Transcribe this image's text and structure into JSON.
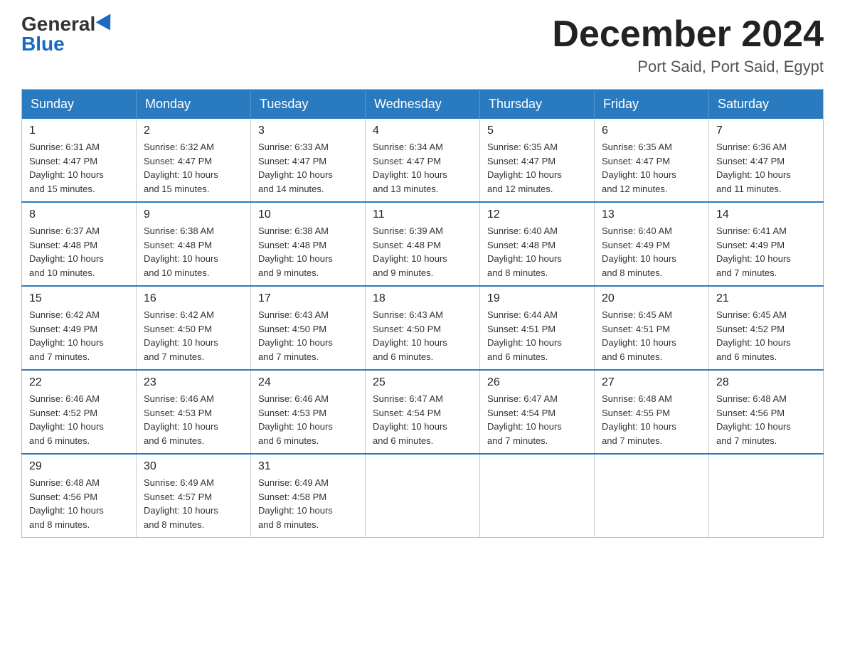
{
  "logo": {
    "general": "General",
    "blue": "Blue"
  },
  "header": {
    "month_year": "December 2024",
    "location": "Port Said, Port Said, Egypt"
  },
  "days_of_week": [
    "Sunday",
    "Monday",
    "Tuesday",
    "Wednesday",
    "Thursday",
    "Friday",
    "Saturday"
  ],
  "weeks": [
    [
      {
        "day": "1",
        "sunrise": "6:31 AM",
        "sunset": "4:47 PM",
        "daylight": "10 hours and 15 minutes."
      },
      {
        "day": "2",
        "sunrise": "6:32 AM",
        "sunset": "4:47 PM",
        "daylight": "10 hours and 15 minutes."
      },
      {
        "day": "3",
        "sunrise": "6:33 AM",
        "sunset": "4:47 PM",
        "daylight": "10 hours and 14 minutes."
      },
      {
        "day": "4",
        "sunrise": "6:34 AM",
        "sunset": "4:47 PM",
        "daylight": "10 hours and 13 minutes."
      },
      {
        "day": "5",
        "sunrise": "6:35 AM",
        "sunset": "4:47 PM",
        "daylight": "10 hours and 12 minutes."
      },
      {
        "day": "6",
        "sunrise": "6:35 AM",
        "sunset": "4:47 PM",
        "daylight": "10 hours and 12 minutes."
      },
      {
        "day": "7",
        "sunrise": "6:36 AM",
        "sunset": "4:47 PM",
        "daylight": "10 hours and 11 minutes."
      }
    ],
    [
      {
        "day": "8",
        "sunrise": "6:37 AM",
        "sunset": "4:48 PM",
        "daylight": "10 hours and 10 minutes."
      },
      {
        "day": "9",
        "sunrise": "6:38 AM",
        "sunset": "4:48 PM",
        "daylight": "10 hours and 10 minutes."
      },
      {
        "day": "10",
        "sunrise": "6:38 AM",
        "sunset": "4:48 PM",
        "daylight": "10 hours and 9 minutes."
      },
      {
        "day": "11",
        "sunrise": "6:39 AM",
        "sunset": "4:48 PM",
        "daylight": "10 hours and 9 minutes."
      },
      {
        "day": "12",
        "sunrise": "6:40 AM",
        "sunset": "4:48 PM",
        "daylight": "10 hours and 8 minutes."
      },
      {
        "day": "13",
        "sunrise": "6:40 AM",
        "sunset": "4:49 PM",
        "daylight": "10 hours and 8 minutes."
      },
      {
        "day": "14",
        "sunrise": "6:41 AM",
        "sunset": "4:49 PM",
        "daylight": "10 hours and 7 minutes."
      }
    ],
    [
      {
        "day": "15",
        "sunrise": "6:42 AM",
        "sunset": "4:49 PM",
        "daylight": "10 hours and 7 minutes."
      },
      {
        "day": "16",
        "sunrise": "6:42 AM",
        "sunset": "4:50 PM",
        "daylight": "10 hours and 7 minutes."
      },
      {
        "day": "17",
        "sunrise": "6:43 AM",
        "sunset": "4:50 PM",
        "daylight": "10 hours and 7 minutes."
      },
      {
        "day": "18",
        "sunrise": "6:43 AM",
        "sunset": "4:50 PM",
        "daylight": "10 hours and 6 minutes."
      },
      {
        "day": "19",
        "sunrise": "6:44 AM",
        "sunset": "4:51 PM",
        "daylight": "10 hours and 6 minutes."
      },
      {
        "day": "20",
        "sunrise": "6:45 AM",
        "sunset": "4:51 PM",
        "daylight": "10 hours and 6 minutes."
      },
      {
        "day": "21",
        "sunrise": "6:45 AM",
        "sunset": "4:52 PM",
        "daylight": "10 hours and 6 minutes."
      }
    ],
    [
      {
        "day": "22",
        "sunrise": "6:46 AM",
        "sunset": "4:52 PM",
        "daylight": "10 hours and 6 minutes."
      },
      {
        "day": "23",
        "sunrise": "6:46 AM",
        "sunset": "4:53 PM",
        "daylight": "10 hours and 6 minutes."
      },
      {
        "day": "24",
        "sunrise": "6:46 AM",
        "sunset": "4:53 PM",
        "daylight": "10 hours and 6 minutes."
      },
      {
        "day": "25",
        "sunrise": "6:47 AM",
        "sunset": "4:54 PM",
        "daylight": "10 hours and 6 minutes."
      },
      {
        "day": "26",
        "sunrise": "6:47 AM",
        "sunset": "4:54 PM",
        "daylight": "10 hours and 7 minutes."
      },
      {
        "day": "27",
        "sunrise": "6:48 AM",
        "sunset": "4:55 PM",
        "daylight": "10 hours and 7 minutes."
      },
      {
        "day": "28",
        "sunrise": "6:48 AM",
        "sunset": "4:56 PM",
        "daylight": "10 hours and 7 minutes."
      }
    ],
    [
      {
        "day": "29",
        "sunrise": "6:48 AM",
        "sunset": "4:56 PM",
        "daylight": "10 hours and 8 minutes."
      },
      {
        "day": "30",
        "sunrise": "6:49 AM",
        "sunset": "4:57 PM",
        "daylight": "10 hours and 8 minutes."
      },
      {
        "day": "31",
        "sunrise": "6:49 AM",
        "sunset": "4:58 PM",
        "daylight": "10 hours and 8 minutes."
      },
      null,
      null,
      null,
      null
    ]
  ],
  "labels": {
    "sunrise": "Sunrise:",
    "sunset": "Sunset:",
    "daylight": "Daylight:"
  }
}
